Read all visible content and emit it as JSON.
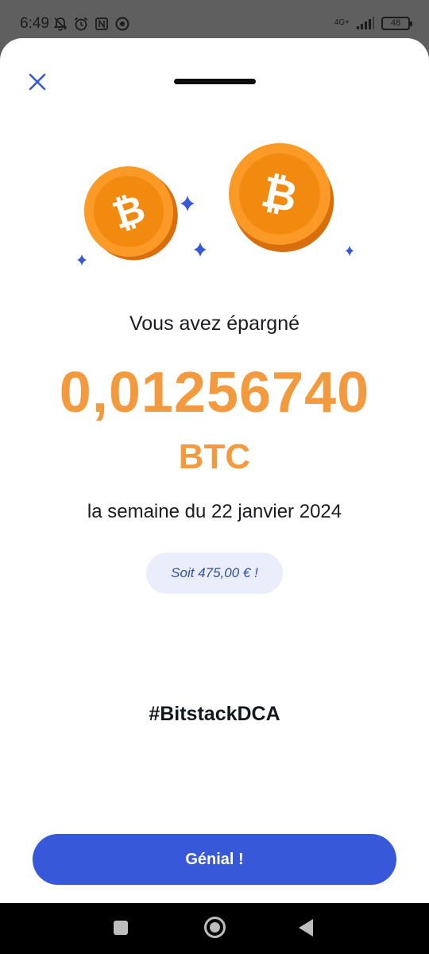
{
  "status_bar": {
    "time": "6:49",
    "network": "4G+",
    "battery": "48"
  },
  "sheet": {
    "saved_label": "Vous avez épargné",
    "amount": "0,01256740",
    "currency": "BTC",
    "week_label": "la semaine du 22 janvier 2024",
    "equivalent": "Soit 475,00 € !",
    "hashtag": "#BitstackDCA",
    "cta_label": "Génial !"
  },
  "colors": {
    "accent_orange": "#f39a3e",
    "primary_blue": "#3758d8",
    "pill_bg": "#e9eefa",
    "pill_text": "#2f4ea8"
  },
  "icons": {
    "close": "close-icon",
    "coin": "bitcoin-coin-icon",
    "sparkle": "sparkle-icon"
  }
}
